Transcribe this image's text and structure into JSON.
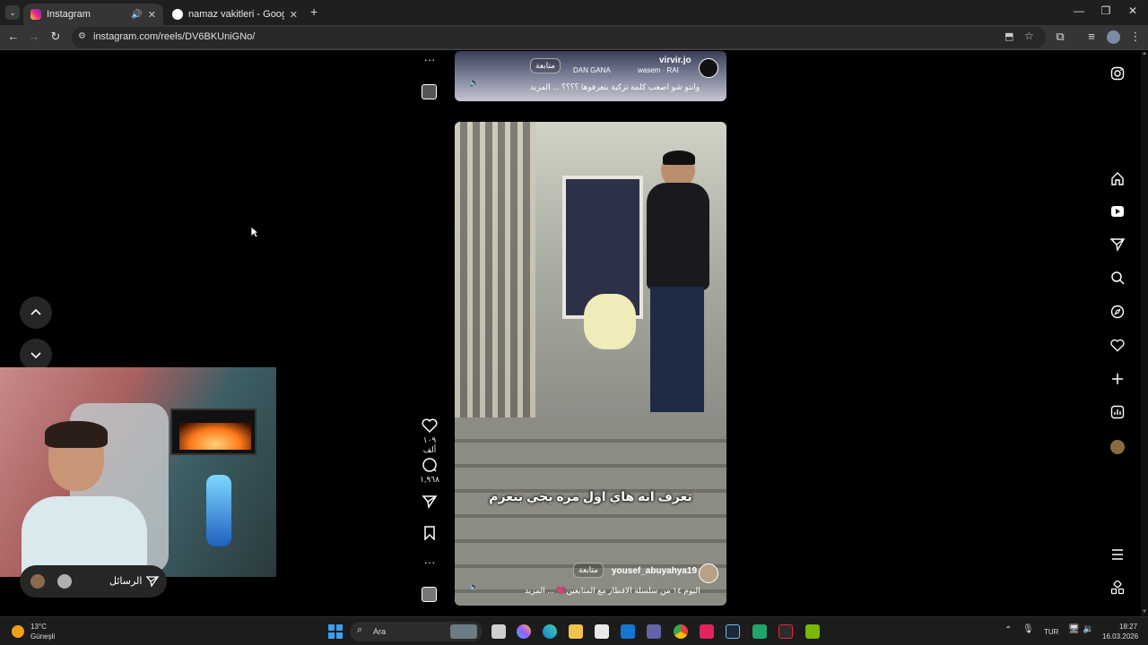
{
  "browser": {
    "tabs": [
      {
        "title": "Instagram",
        "active": true
      },
      {
        "title": "namaz vakitleri - Google'da Ara",
        "active": false
      }
    ],
    "new_tab_label": "+",
    "url": "instagram.com/reels/DV6BKUniGNo/"
  },
  "reel_top": {
    "username": "virvir.jo",
    "audio": "wasem · RAI",
    "follow_label": "متابعة",
    "overlay_text": "DAN GANA",
    "caption": "وانتو شو اصعب كلمة تركية بتعرفوها ؟؟؟؟ ... المزيد"
  },
  "reel_main": {
    "subtitle": "تعرف انه هاي اول مره يجي بنعزم",
    "username": "yousef_abuyahya19",
    "follow_label": "متابعة",
    "caption": "اليوم ١٤ من سلسلة الافطار مع المتابعين💗 ... المزيد",
    "likes": "١٠٩ ألف",
    "comments": "١,٩٦٨"
  },
  "messages_bar": {
    "label": "الرسائل"
  },
  "taskbar": {
    "weather_temp": "13°C",
    "weather_desc": "Güneşli",
    "search_placeholder": "Ara",
    "language": "TUR",
    "time": "18:27",
    "date": "16.03.2026"
  },
  "colors": {
    "tabstrip": "#1f1f1f",
    "toolbar": "#353535",
    "page": "#000000",
    "like_accent": "#ff3040"
  }
}
